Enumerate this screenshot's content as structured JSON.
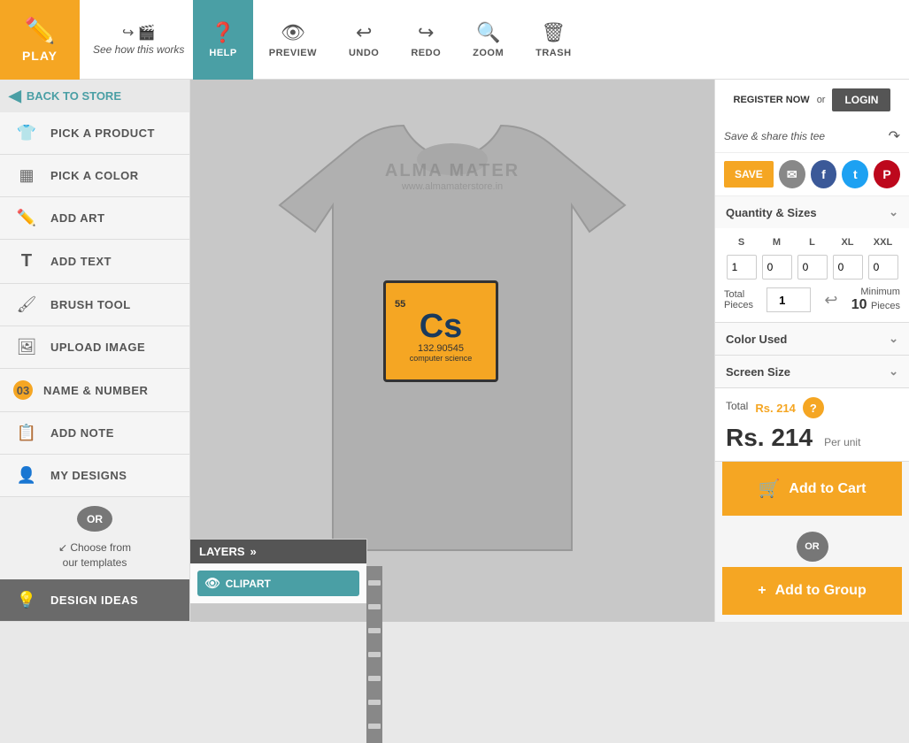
{
  "topbar": {
    "play_label": "PLAY",
    "see_how_label": "See how this works",
    "help_label": "HELP",
    "preview_label": "PREVIEW",
    "undo_label": "UNDO",
    "redo_label": "REDO",
    "zoom_label": "ZOOM",
    "trash_label": "TRASH"
  },
  "sidebar": {
    "back_to_store": "BACK TO STORE",
    "items": [
      {
        "id": "pick-product",
        "label": "PICK A PRODUCT",
        "icon": "👕"
      },
      {
        "id": "pick-color",
        "label": "PICK A COLOR",
        "icon": "🎨"
      },
      {
        "id": "add-art",
        "label": "ADD ART",
        "icon": "✏️"
      },
      {
        "id": "add-text",
        "label": "ADD TEXT",
        "icon": "T"
      },
      {
        "id": "brush-tool",
        "label": "BRUSH TOOL",
        "icon": "🖌"
      },
      {
        "id": "upload-image",
        "label": "UPLOAD IMAGE",
        "icon": "🖼"
      },
      {
        "id": "name-number",
        "label": "NAME & NUMBER",
        "icon": "03"
      },
      {
        "id": "add-note",
        "label": "ADD NOTE",
        "icon": "📎"
      },
      {
        "id": "my-designs",
        "label": "MY DESIGNS",
        "icon": "👤"
      }
    ],
    "or_label": "OR",
    "choose_templates_line1": "Choose from",
    "choose_templates_line2": "our templates",
    "design_ideas_label": "DESIGN IDEAS"
  },
  "layers": {
    "title": "LAYERS",
    "clipart_label": "CLIPART"
  },
  "right_panel": {
    "register_label": "REGISTER NOW",
    "auth_or": "or",
    "login_label": "LOGIN",
    "save_share_text": "Save & share this tee",
    "save_label": "SAVE",
    "qty_sizes_title": "Quantity & Sizes",
    "sizes": [
      "S",
      "M",
      "L",
      "XL",
      "XXL"
    ],
    "size_values": [
      "1",
      "0",
      "0",
      "0",
      "0"
    ],
    "total_pieces_label": "Total Pieces",
    "total_value": "1",
    "min_label": "Minimum",
    "min_value": "10",
    "min_pieces_label": "Pieces",
    "color_used_title": "Color Used",
    "screen_size_title": "Screen Size",
    "total_label": "Total",
    "total_price": "Rs. 214",
    "price_main": "Rs. 214",
    "per_unit_label": "Per unit",
    "add_to_cart_label": "Add to Cart",
    "or_label": "OR",
    "add_to_group_label": "Add to Group"
  },
  "clipart": {
    "number": "55",
    "symbol": "Cs",
    "mass": "132.90545",
    "name": "computer science"
  },
  "watermark": {
    "title": "ALMA MATER",
    "url": "www.almamaterstore.in"
  }
}
